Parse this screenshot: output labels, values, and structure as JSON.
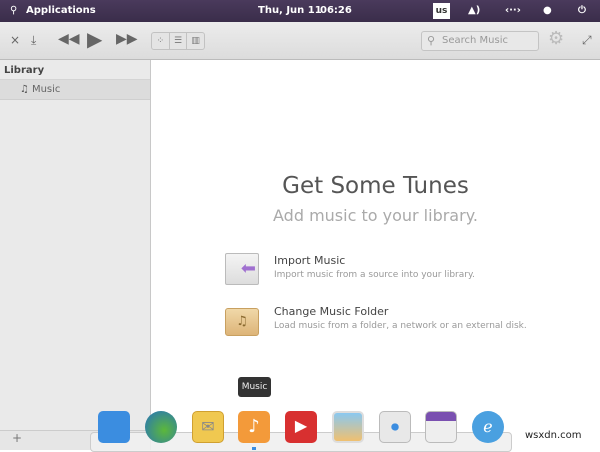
{
  "panel": {
    "applications": "Applications",
    "date": "Thu, Jun 11",
    "time": "06:26",
    "keyboard": "us"
  },
  "toolbar": {
    "search_placeholder": "Search Music"
  },
  "sidebar": {
    "header": "Library",
    "items": [
      {
        "label": "Music",
        "icon": "music-note-icon"
      }
    ]
  },
  "main": {
    "title": "Get Some Tunes",
    "subtitle": "Add music to your library.",
    "actions": [
      {
        "title": "Import Music",
        "desc": "Import music from a source into your library."
      },
      {
        "title": "Change Music Folder",
        "desc": "Load music from a folder, a network or an external disk."
      }
    ]
  },
  "dock": {
    "tooltip": "Music",
    "items": [
      "multitasking-view",
      "web-browser",
      "mail",
      "music",
      "videos",
      "photos",
      "system-settings",
      "app-center",
      "installer"
    ]
  },
  "watermark": "wsxdn.com",
  "colors": {
    "panel": "#3a2d4a",
    "accent": "#f39a3a"
  }
}
